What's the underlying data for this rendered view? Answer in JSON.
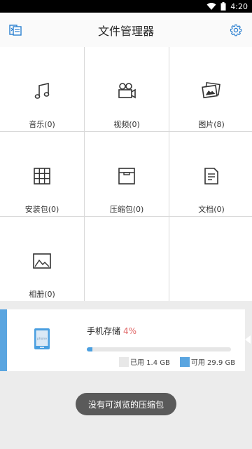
{
  "status_bar": {
    "time": "4:20"
  },
  "app_bar": {
    "title": "文件管理器"
  },
  "categories": [
    {
      "label": "音乐(0)",
      "icon": "music-note-icon"
    },
    {
      "label": "视频(0)",
      "icon": "video-camera-icon"
    },
    {
      "label": "图片(8)",
      "icon": "pictures-icon"
    },
    {
      "label": "安装包(0)",
      "icon": "package-grid-icon"
    },
    {
      "label": "压缩包(0)",
      "icon": "archive-box-icon"
    },
    {
      "label": "文档(0)",
      "icon": "document-icon"
    },
    {
      "label": "相册(0)",
      "icon": "album-icon"
    }
  ],
  "storage": {
    "title": "手机存储",
    "percent_label": "4%",
    "used_fraction": 0.04,
    "used_label": "已用 1.4 GB",
    "available_label": "可用 29.9 GB",
    "used_color": "#e8e8e8",
    "available_color": "#5aa5e0",
    "phone_icon_text": "phone"
  },
  "toast": {
    "message": "没有可浏览的压缩包"
  }
}
